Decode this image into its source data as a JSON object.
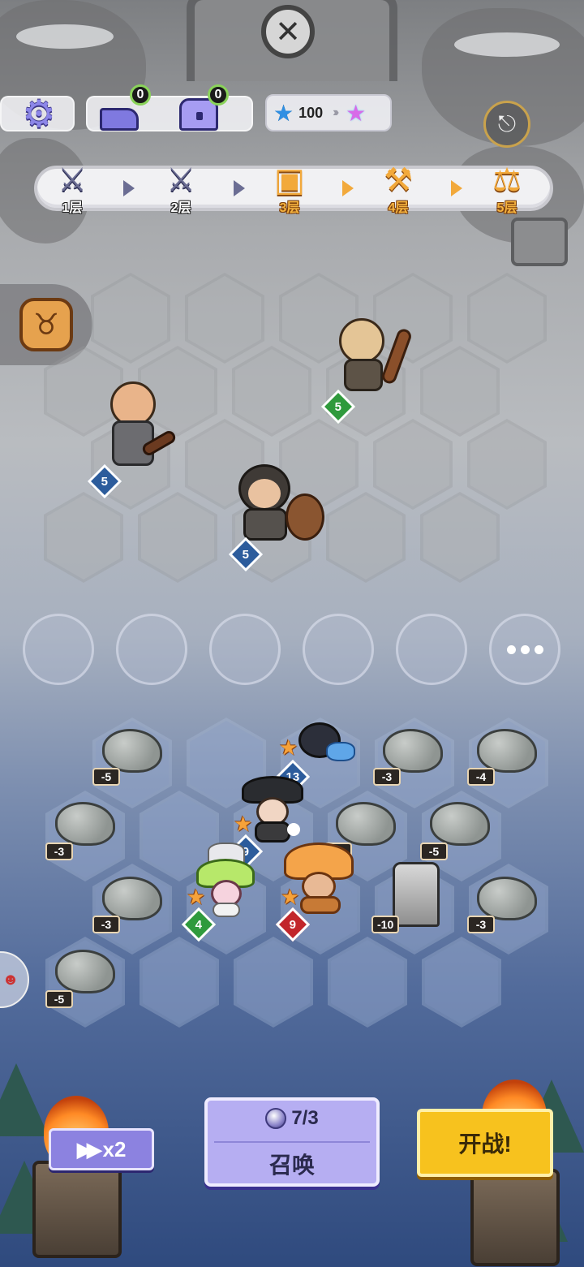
{
  "topbar": {
    "anvil_count": "0",
    "chest_count": "0",
    "star_value": "100",
    "icons": [
      "gear-icon",
      "anvil-icon",
      "chest-icon",
      "star-icon",
      "rainbow-star-icon",
      "exit-icon"
    ]
  },
  "floors": [
    {
      "label": "1层",
      "icon": "crossed-swords-icon",
      "state": "done"
    },
    {
      "label": "2层",
      "icon": "crossed-swords-icon",
      "state": "done"
    },
    {
      "label": "3层",
      "icon": "treasure-chest-icon",
      "state": "current"
    },
    {
      "label": "4层",
      "icon": "anvil-icon",
      "state": "upcoming"
    },
    {
      "label": "5层",
      "icon": "scales-icon",
      "state": "upcoming"
    }
  ],
  "enemies": [
    {
      "name": "bald-dwarf-club",
      "level": "5",
      "color": "green"
    },
    {
      "name": "bearded-dwarf-pickaxe",
      "level": "5",
      "color": "blue"
    },
    {
      "name": "hooded-dwarf-shield",
      "level": "5",
      "color": "blue"
    }
  ],
  "player_units": [
    {
      "name": "shadow-octopus",
      "level": "13",
      "color": "blue",
      "star": true
    },
    {
      "name": "witch-hat-archer",
      "level": "9",
      "color": "blue",
      "star": true
    },
    {
      "name": "green-mushroom-girl",
      "level": "4",
      "color": "green",
      "star": true
    },
    {
      "name": "orange-mushroom-warrior",
      "level": "9",
      "color": "red",
      "star": true
    }
  ],
  "rocks": [
    "-5",
    "-3",
    "-4",
    "-3",
    "-5",
    "-5",
    "-3",
    "-3",
    "-5"
  ],
  "tower_hp": "-10",
  "controls": {
    "speed_label": "x2",
    "summon_cost": "7/3",
    "summon_label": "召唤",
    "fight_label": "开战!"
  },
  "colors": {
    "accent_purple": "#8c82e0",
    "fight_yellow": "#f7c21e",
    "floor_gold": "#f2a93b",
    "floor_done": "#6b6d93"
  }
}
